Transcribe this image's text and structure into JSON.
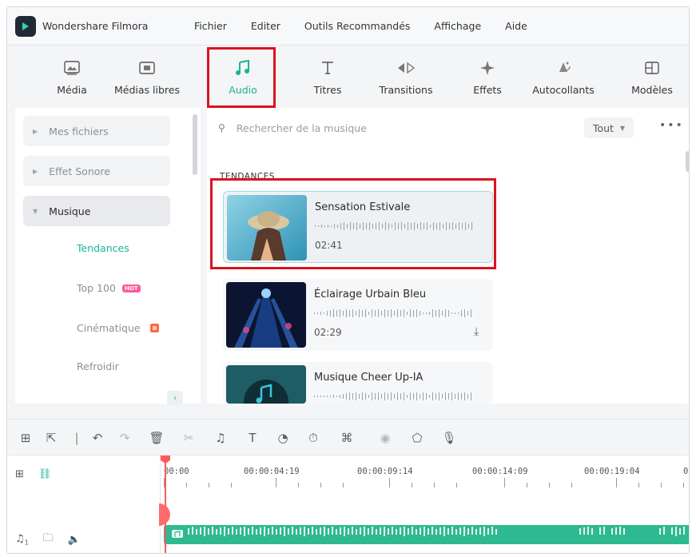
{
  "app": {
    "title": "Wondershare Filmora",
    "menu": [
      "Fichier",
      "Editer",
      "Outils Recommandés",
      "Affichage",
      "Aide"
    ]
  },
  "toolbar": {
    "tabs": [
      {
        "label": "Média",
        "icon": "media-icon"
      },
      {
        "label": "Médias libres",
        "icon": "stock-media-icon"
      },
      {
        "label": "Audio",
        "icon": "music-note-icon",
        "active": true
      },
      {
        "label": "Titres",
        "icon": "titles-icon"
      },
      {
        "label": "Transitions",
        "icon": "transitions-icon"
      },
      {
        "label": "Effets",
        "icon": "effects-icon"
      },
      {
        "label": "Autocollants",
        "icon": "stickers-icon"
      },
      {
        "label": "Modèles",
        "icon": "templates-icon"
      }
    ]
  },
  "sidebar": {
    "items": [
      {
        "label": "Mes fichiers"
      },
      {
        "label": "Effet Sonore"
      },
      {
        "label": "Musique",
        "expanded": true
      }
    ],
    "subitems": [
      {
        "label": "Tendances",
        "active": true
      },
      {
        "label": "Top 100",
        "badge": "HOT"
      },
      {
        "label": "Cinématique"
      },
      {
        "label": "Refroidir"
      }
    ]
  },
  "search": {
    "placeholder": "Rechercher de la musique",
    "filter": "Tout"
  },
  "section_title": "TENDANCES",
  "tracks": [
    {
      "title": "Sensation Estivale",
      "duration": "02:41",
      "selected": true
    },
    {
      "title": "Éclairage Urbain Bleu",
      "duration": "02:29"
    },
    {
      "title": "Musique Cheer Up-IA",
      "duration": ""
    }
  ],
  "timeline": {
    "timecodes": [
      "00:00",
      "00:00:04:19",
      "00:00:09:14",
      "00:00:14:09",
      "00:00:19:04",
      "0"
    ],
    "track_number": "1"
  },
  "colors": {
    "accent": "#1ab493",
    "highlight": "#d9141e",
    "audio_clip": "#2fb990",
    "playhead": "#ff5a5a"
  }
}
